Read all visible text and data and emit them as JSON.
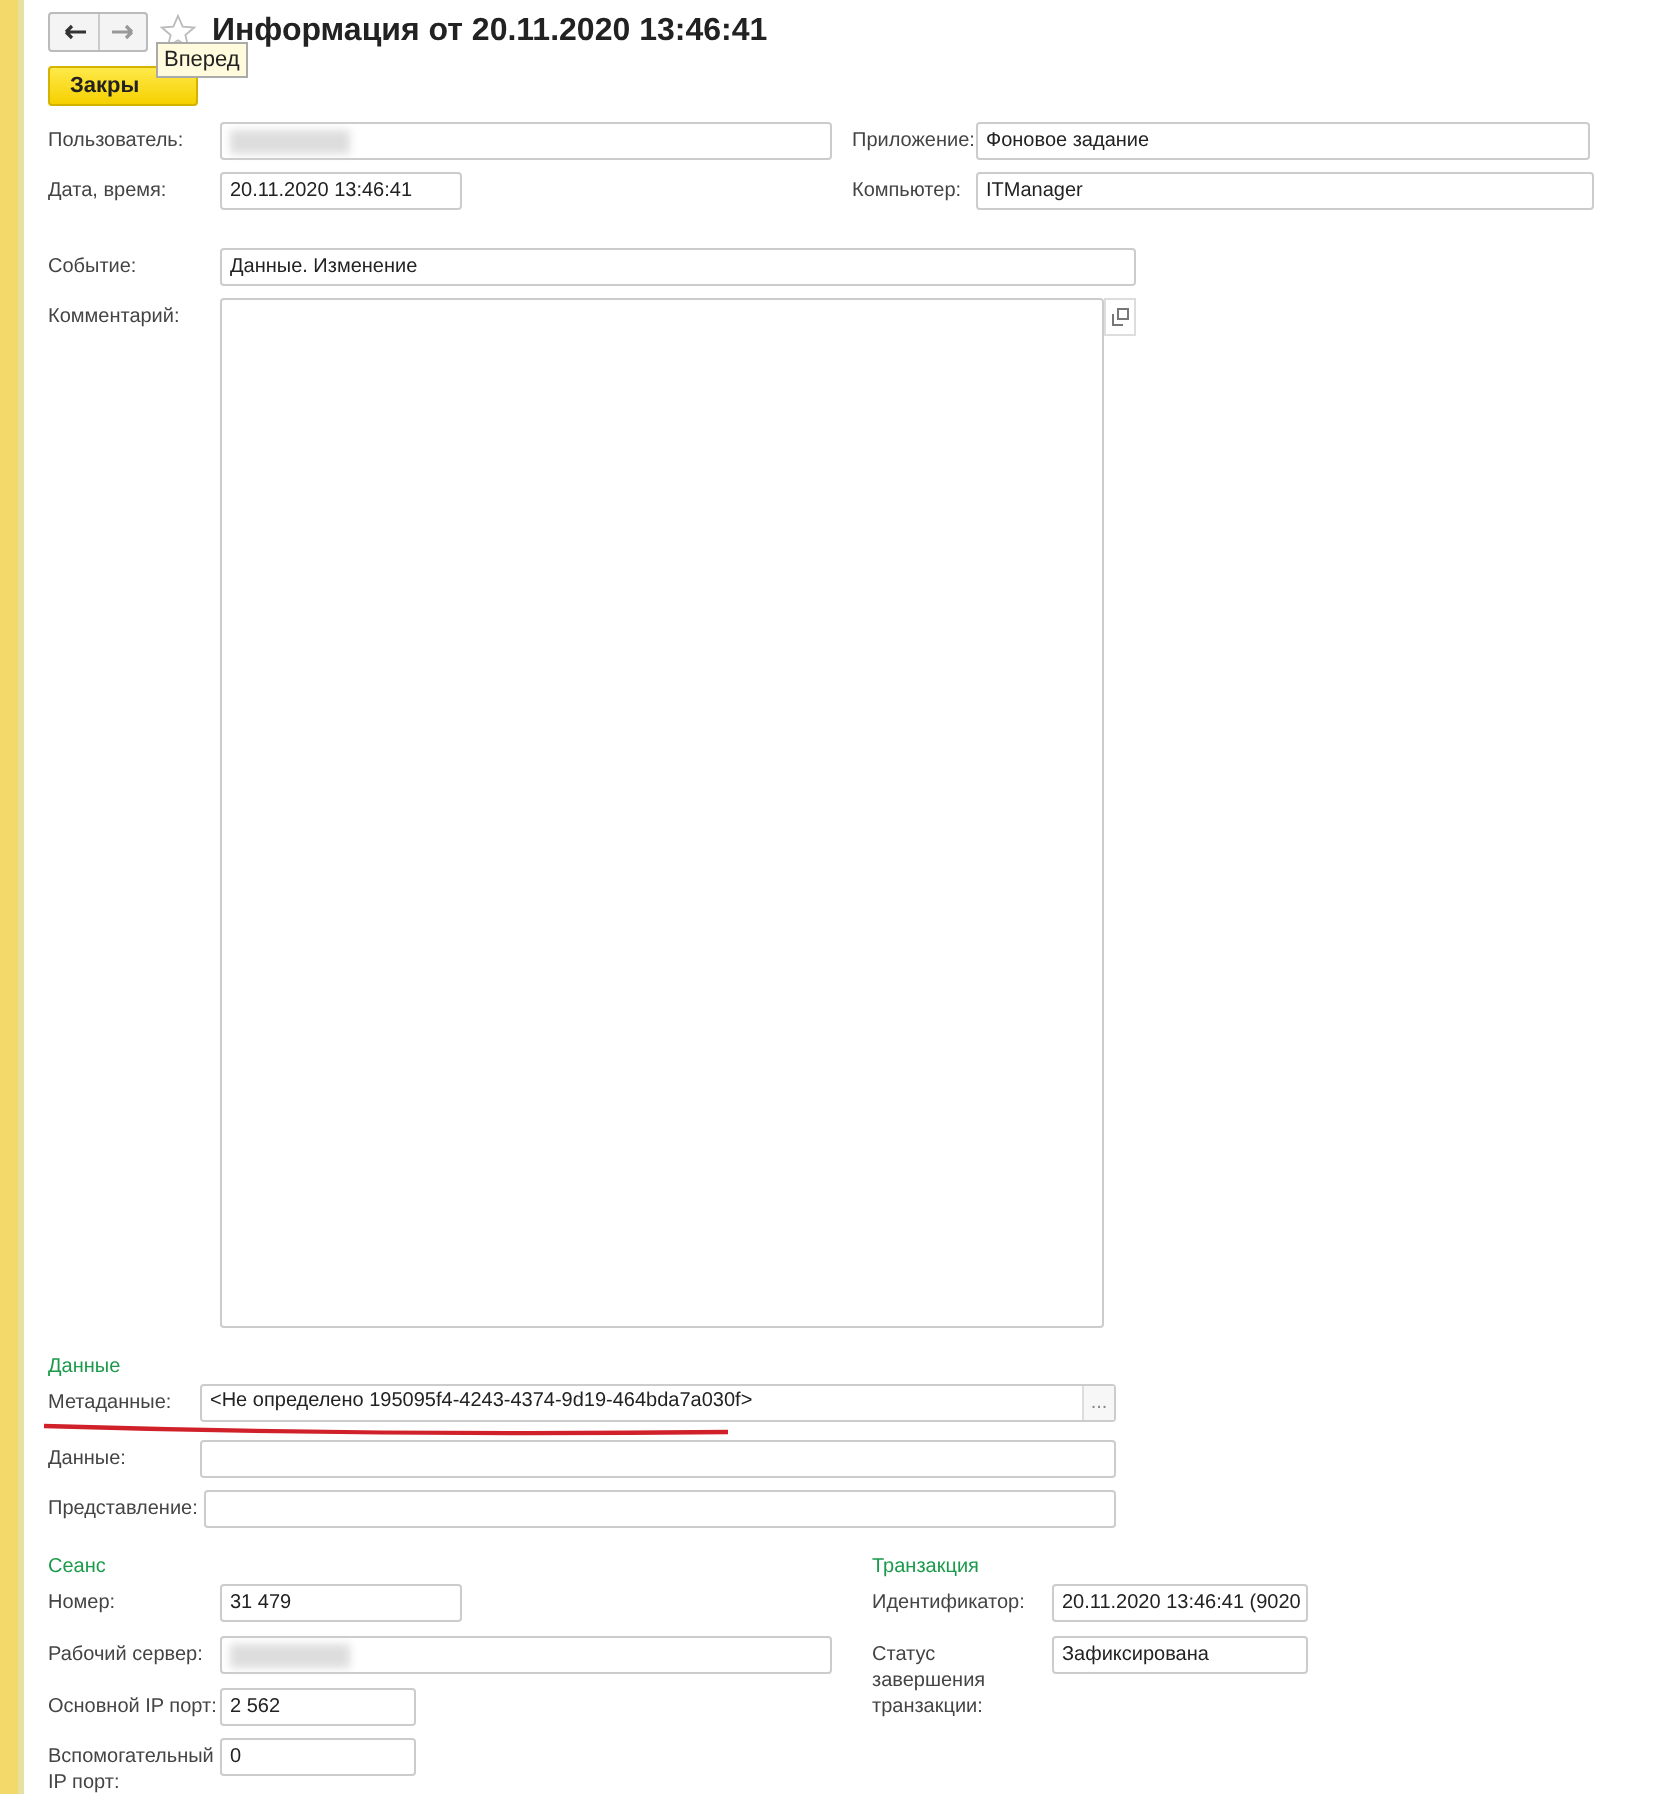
{
  "window": {
    "title": "Информация от 20.11.2020 13:46:41"
  },
  "toolbar": {
    "close_button": "Закры",
    "tooltip": "Вперед"
  },
  "main": {
    "user": {
      "label": "Пользователь:",
      "blurred": true
    },
    "application": {
      "label": "Приложение:",
      "value": "Фоновое задание"
    },
    "datetime": {
      "label": "Дата, время:",
      "value": "20.11.2020 13:46:41"
    },
    "computer": {
      "label": "Компьютер:",
      "value": "ITManager"
    },
    "event": {
      "label": "Событие:",
      "value": "Данные. Изменение"
    },
    "comment": {
      "label": "Комментарий:"
    }
  },
  "data_section": {
    "title": "Данные",
    "metadata": {
      "label": "Метаданные:",
      "value": "<Не определено 195095f4-4243-4374-9d19-464bda7a030f>",
      "select_button": "..."
    },
    "data": {
      "label": "Данные:"
    },
    "presentation": {
      "label": "Представление:"
    }
  },
  "session": {
    "title": "Сеанс",
    "number": {
      "label": "Номер:",
      "value": "31 479"
    },
    "server": {
      "label": "Рабочий сервер:",
      "blurred": true
    },
    "main_port": {
      "label": "Основной IP порт:",
      "value": "2 562"
    },
    "aux_port": {
      "label": "Вспомогательный IP порт:",
      "value": "0"
    }
  },
  "transaction": {
    "title": "Транзакция",
    "id": {
      "label": "Идентификатор:",
      "value": "20.11.2020 13:46:41 (9020"
    },
    "status": {
      "label": "Статус завершения транзакции:",
      "value": "Зафиксирована"
    }
  }
}
